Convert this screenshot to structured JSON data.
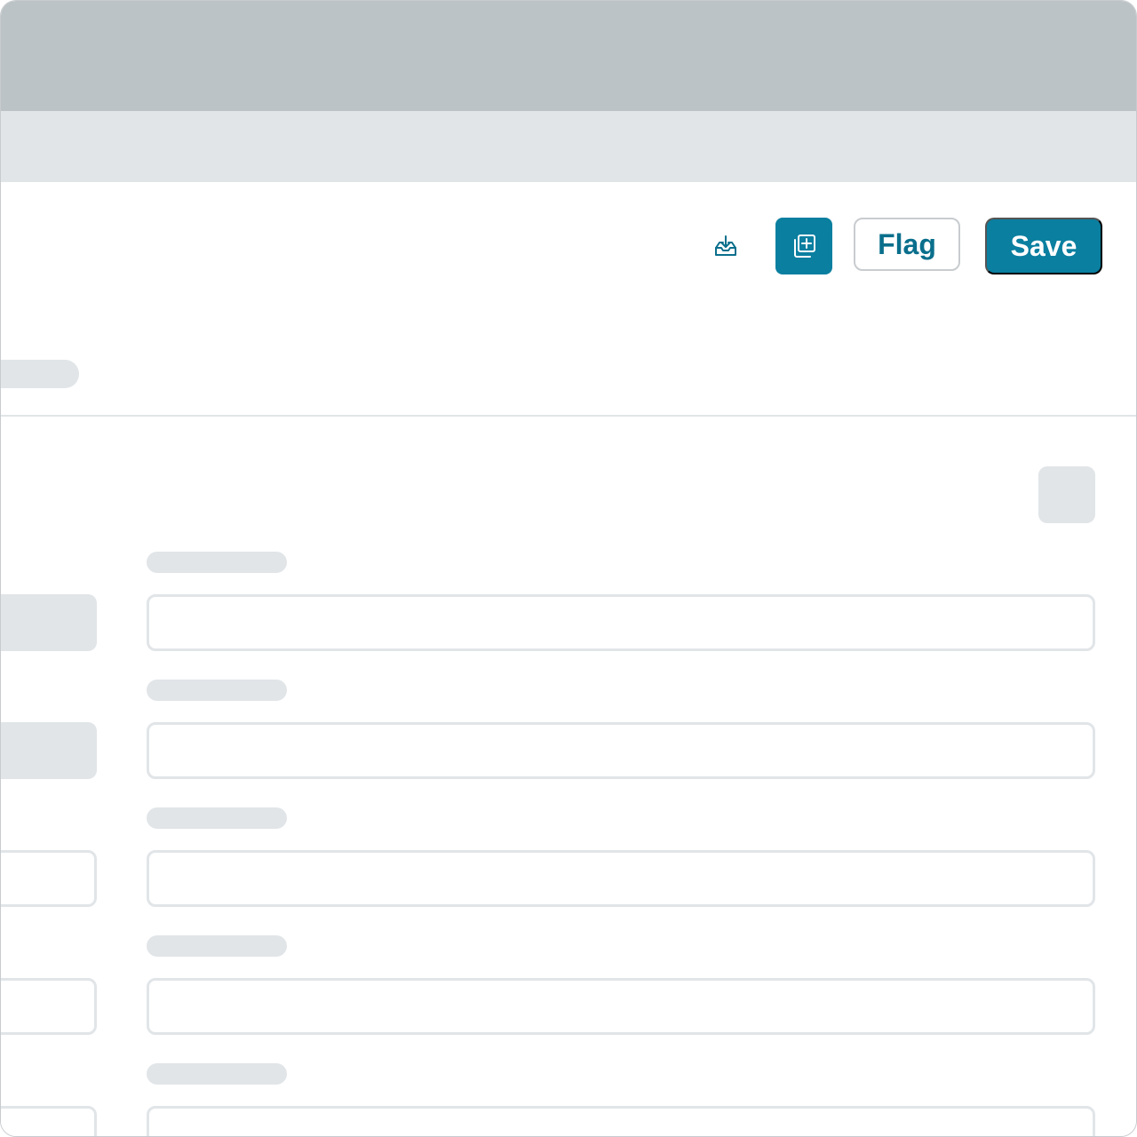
{
  "toolbar": {
    "import_icon": "tray-download-icon",
    "duplicate_icon": "add-copy-icon",
    "flag_label": "Flag",
    "save_label": "Save"
  },
  "colors": {
    "accent": "#0a7fa0",
    "titlebar": "#bcc3c6",
    "subbar": "#e1e5e8",
    "skeleton": "#e1e5e8"
  }
}
